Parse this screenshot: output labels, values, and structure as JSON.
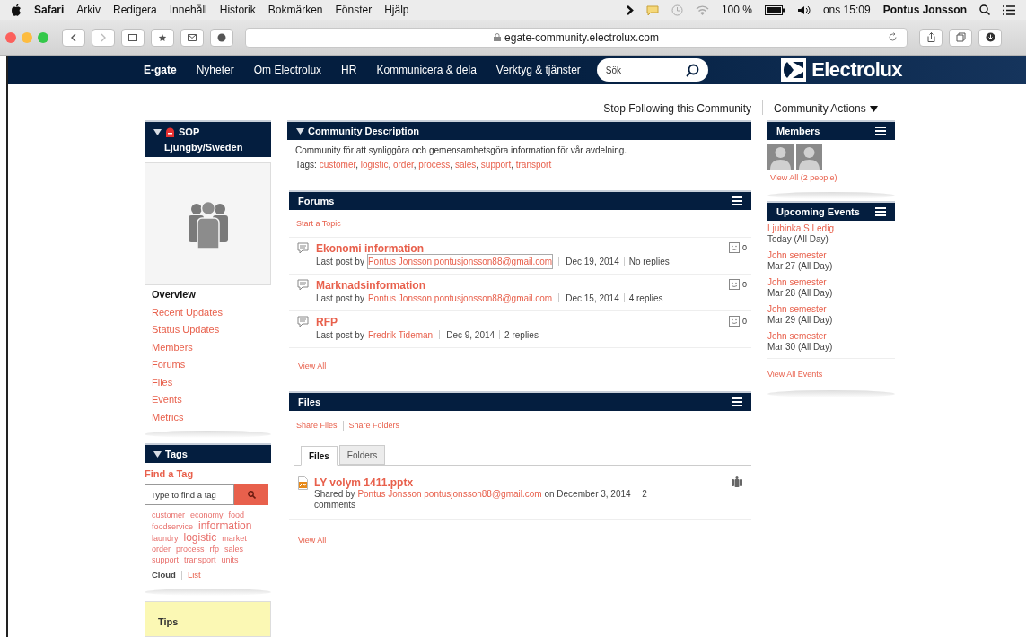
{
  "menubar": {
    "app": "Safari",
    "menus": [
      "Arkiv",
      "Redigera",
      "Innehåll",
      "Historik",
      "Bokmärken",
      "Fönster",
      "Hjälp"
    ],
    "battery": "100 %",
    "clock": "ons 15:09",
    "user": "Pontus Jonsson"
  },
  "toolbar": {
    "url": "egate-community.electrolux.com"
  },
  "nav": {
    "items": [
      {
        "label": "E-gate",
        "selected": true
      },
      {
        "label": "Nyheter",
        "selected": false
      },
      {
        "label": "Om Electrolux",
        "selected": false
      },
      {
        "label": "HR",
        "selected": false
      },
      {
        "label": "Kommunicera & dela",
        "selected": false
      },
      {
        "label": "Verktyg & tjänster",
        "selected": false
      }
    ],
    "search_placeholder": "Sök",
    "logo": "Electrolux"
  },
  "actions": {
    "follow": "Stop Following this Community",
    "menu": "Community Actions"
  },
  "community": {
    "title": [
      "SOP",
      "Ljungby/Sweden"
    ],
    "items": [
      {
        "label": "Overview",
        "selected": true
      },
      {
        "label": "Recent Updates",
        "selected": false
      },
      {
        "label": "Status Updates",
        "selected": false
      },
      {
        "label": "Members",
        "selected": false
      },
      {
        "label": "Forums",
        "selected": false
      },
      {
        "label": "Files",
        "selected": false
      },
      {
        "label": "Events",
        "selected": false
      },
      {
        "label": "Metrics",
        "selected": false
      }
    ]
  },
  "tags": {
    "title": "Tags",
    "find": "Find a Tag",
    "placeholder": "Type to find a tag",
    "cloud": [
      {
        "label": "customer",
        "kind": "small"
      },
      {
        "label": "economy",
        "kind": "small"
      },
      {
        "label": "food",
        "kind": "small"
      },
      {
        "label": "foodservice",
        "kind": "small"
      },
      {
        "label": "information",
        "kind": "large"
      },
      {
        "label": "laundry",
        "kind": "small"
      },
      {
        "label": "logistic",
        "kind": "large"
      },
      {
        "label": "market",
        "kind": "small"
      },
      {
        "label": "order",
        "kind": "small"
      },
      {
        "label": "process",
        "kind": "small"
      },
      {
        "label": "rfp",
        "kind": "small"
      },
      {
        "label": "sales",
        "kind": "small"
      },
      {
        "label": "support",
        "kind": "small"
      },
      {
        "label": "transport",
        "kind": "small"
      },
      {
        "label": "units",
        "kind": "small"
      }
    ],
    "views": [
      {
        "label": "Cloud",
        "selected": true
      },
      {
        "label": "List",
        "selected": false
      }
    ]
  },
  "tips": {
    "title": "Tips"
  },
  "description": {
    "title": "Community Description",
    "text": "Community för att synliggöra och gemensamhetsgöra information för vår avdelning.",
    "tags_label": "Tags:",
    "separator": ",",
    "tags": [
      "customer",
      "logistic",
      "order",
      "process",
      "sales",
      "support",
      "transport"
    ]
  },
  "forums": {
    "title": "Forums",
    "start": "Start a Topic",
    "topics": [
      {
        "title": "Ekonomi information",
        "prefix": "Last post by",
        "author": "Pontus Jonsson pontusjonsson88@gmail.com",
        "focused": true,
        "date": "Dec 19, 2014",
        "replies": "No replies",
        "count": "0"
      },
      {
        "title": "Marknadsinformation",
        "prefix": "Last post by",
        "author": "Pontus Jonsson pontusjonsson88@gmail.com",
        "focused": false,
        "date": "Dec 15, 2014",
        "replies": "4 replies",
        "count": "0"
      },
      {
        "title": "RFP",
        "prefix": "Last post by",
        "author": "Fredrik Tideman",
        "focused": false,
        "date": "Dec 9, 2014",
        "replies": "2 replies",
        "count": "0"
      }
    ],
    "view_all": "View All"
  },
  "files": {
    "title": "Files",
    "actions": [
      "Share Files",
      "Share Folders"
    ],
    "tabs": [
      {
        "label": "Files",
        "selected": true
      },
      {
        "label": "Folders",
        "selected": false
      }
    ],
    "items": [
      {
        "name": "LY volym 1411.pptx",
        "prefix": "Shared by",
        "author": "Pontus Jonsson pontusjonsson88@gmail.com",
        "date": "on December 3, 2014",
        "comments": "2 comments"
      }
    ],
    "view_all": "View All"
  },
  "members": {
    "title": "Members",
    "view_all": "View All (2 people)"
  },
  "events": {
    "title": "Upcoming Events",
    "items": [
      {
        "name": "Ljubinka S Ledig",
        "when": "Today (All Day)"
      },
      {
        "name": "John semester",
        "when": "Mar 27 (All Day)"
      },
      {
        "name": "John semester",
        "when": "Mar 28 (All Day)"
      },
      {
        "name": "John semester",
        "when": "Mar 29 (All Day)"
      },
      {
        "name": "John semester",
        "when": "Mar 30 (All Day)"
      }
    ],
    "view_all": "View All Events"
  }
}
